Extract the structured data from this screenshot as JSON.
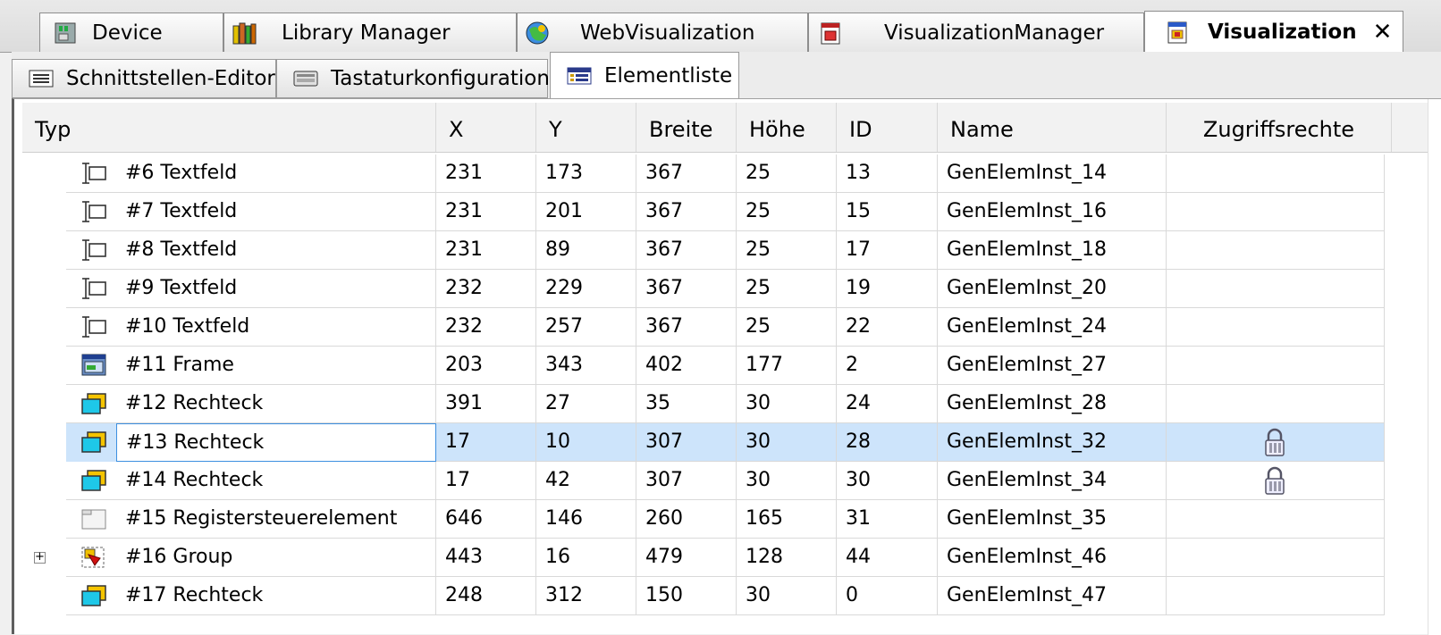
{
  "doc_tabs": [
    {
      "label": "Device",
      "icon": "device-icon"
    },
    {
      "label": "Library Manager",
      "icon": "library-icon"
    },
    {
      "label": "WebVisualization",
      "icon": "web-visu-icon"
    },
    {
      "label": "VisualizationManager",
      "icon": "visu-manager-icon"
    },
    {
      "label": "Visualization",
      "icon": "visualization-icon",
      "active": true,
      "close": "✕"
    }
  ],
  "sub_tabs": [
    {
      "label": "Schnittstellen-Editor",
      "icon": "interface-editor-icon"
    },
    {
      "label": "Tastaturkonfiguration",
      "icon": "keyboard-icon"
    },
    {
      "label": "Elementliste",
      "icon": "element-list-icon",
      "active": true
    }
  ],
  "grid": {
    "columns": [
      "Typ",
      "X",
      "Y",
      "Breite",
      "Höhe",
      "ID",
      "Name",
      "Zugriffsrechte"
    ],
    "rows": [
      {
        "typ": "#6 Textfeld",
        "icon": "textfield-icon",
        "x": "231",
        "y": "173",
        "breite": "367",
        "hoehe": "25",
        "id": "13",
        "name": "GenElemInst_14",
        "locked": false
      },
      {
        "typ": "#7 Textfeld",
        "icon": "textfield-icon",
        "x": "231",
        "y": "201",
        "breite": "367",
        "hoehe": "25",
        "id": "15",
        "name": "GenElemInst_16",
        "locked": false
      },
      {
        "typ": "#8 Textfeld",
        "icon": "textfield-icon",
        "x": "231",
        "y": "89",
        "breite": "367",
        "hoehe": "25",
        "id": "17",
        "name": "GenElemInst_18",
        "locked": false
      },
      {
        "typ": "#9 Textfeld",
        "icon": "textfield-icon",
        "x": "232",
        "y": "229",
        "breite": "367",
        "hoehe": "25",
        "id": "19",
        "name": "GenElemInst_20",
        "locked": false
      },
      {
        "typ": "#10 Textfeld",
        "icon": "textfield-icon",
        "x": "232",
        "y": "257",
        "breite": "367",
        "hoehe": "25",
        "id": "22",
        "name": "GenElemInst_24",
        "locked": false
      },
      {
        "typ": "#11 Frame",
        "icon": "frame-icon",
        "x": "203",
        "y": "343",
        "breite": "402",
        "hoehe": "177",
        "id": "2",
        "name": "GenElemInst_27",
        "locked": false
      },
      {
        "typ": "#12 Rechteck",
        "icon": "rectangle-icon",
        "x": "391",
        "y": "27",
        "breite": "35",
        "hoehe": "30",
        "id": "24",
        "name": "GenElemInst_28",
        "locked": false
      },
      {
        "typ": "#13 Rechteck",
        "icon": "rectangle-icon",
        "x": "17",
        "y": "10",
        "breite": "307",
        "hoehe": "30",
        "id": "28",
        "name": "GenElemInst_32",
        "locked": true,
        "selected": true
      },
      {
        "typ": "#14 Rechteck",
        "icon": "rectangle-icon",
        "x": "17",
        "y": "42",
        "breite": "307",
        "hoehe": "30",
        "id": "30",
        "name": "GenElemInst_34",
        "locked": true
      },
      {
        "typ": "#15 Registersteuerelement",
        "icon": "tab-control-icon",
        "x": "646",
        "y": "146",
        "breite": "260",
        "hoehe": "165",
        "id": "31",
        "name": "GenElemInst_35",
        "locked": false
      },
      {
        "typ": "#16 Group",
        "icon": "group-icon",
        "x": "443",
        "y": "16",
        "breite": "479",
        "hoehe": "128",
        "id": "44",
        "name": "GenElemInst_46",
        "locked": false,
        "expandable": true
      },
      {
        "typ": "#17 Rechteck",
        "icon": "rectangle-icon",
        "x": "248",
        "y": "312",
        "breite": "150",
        "hoehe": "30",
        "id": "0",
        "name": "GenElemInst_47",
        "locked": false
      }
    ]
  }
}
